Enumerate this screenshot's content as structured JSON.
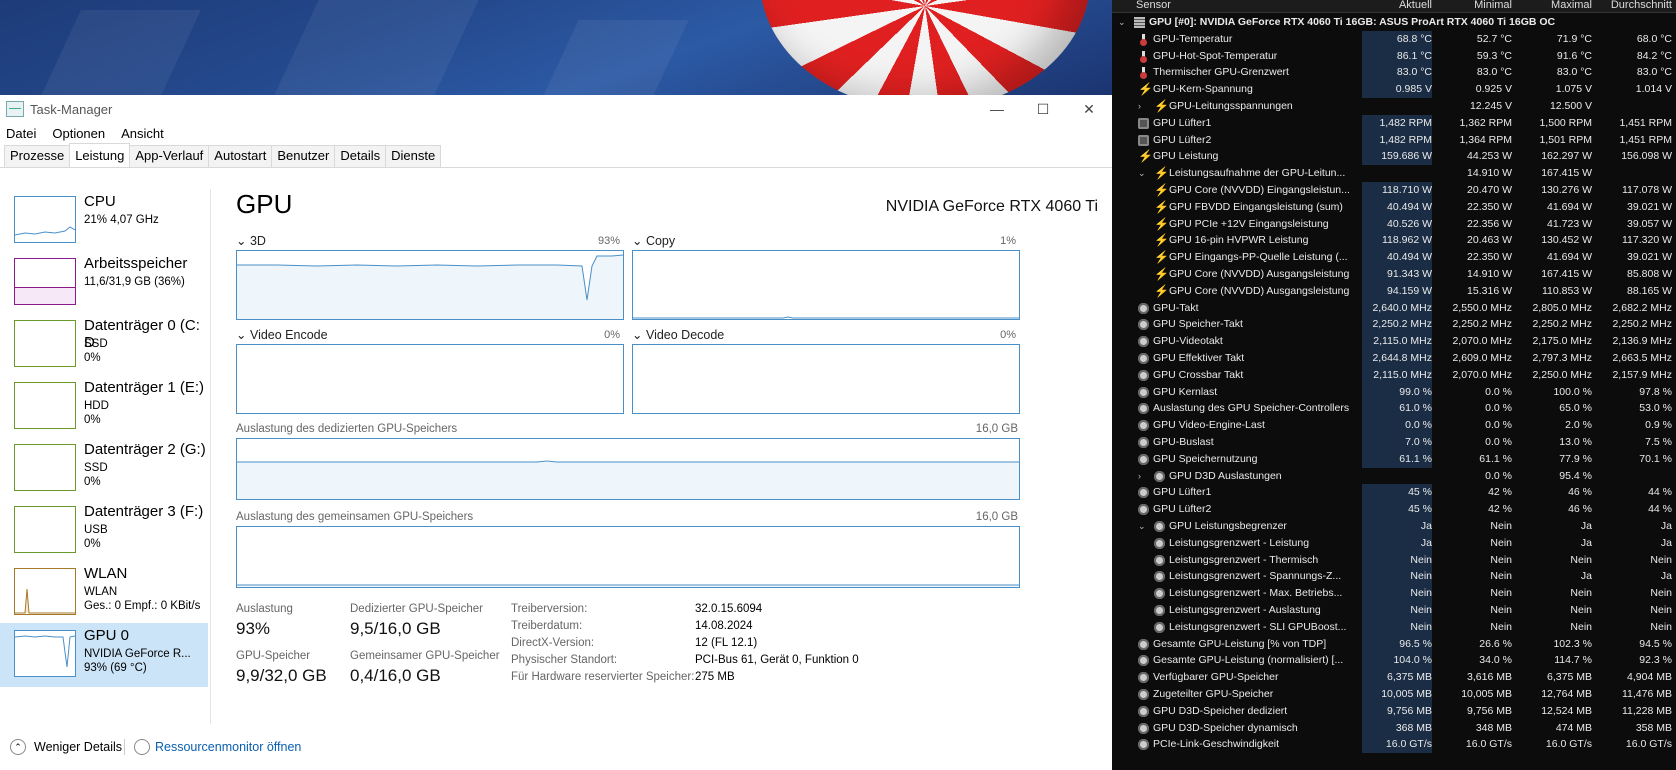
{
  "taskmanager": {
    "title": "Task-Manager",
    "window_controls": [
      "—",
      "☐",
      "✕"
    ],
    "menu": [
      "Datei",
      "Optionen",
      "Ansicht"
    ],
    "tabs": [
      "Prozesse",
      "Leistung",
      "App-Verlauf",
      "Autostart",
      "Benutzer",
      "Details",
      "Dienste"
    ],
    "active_tab": "Leistung",
    "sidebar": [
      {
        "name": "CPU",
        "sub1": "21% 4,07 GHz",
        "sub2": ""
      },
      {
        "name": "Arbeitsspeicher",
        "sub1": "11,6/31,9 GB (36%)",
        "sub2": ""
      },
      {
        "name": "Datenträger 0 (C: D",
        "sub1": "SSD",
        "sub2": "0%"
      },
      {
        "name": "Datenträger 1 (E:)",
        "sub1": "HDD",
        "sub2": "0%"
      },
      {
        "name": "Datenträger 2 (G:)",
        "sub1": "SSD",
        "sub2": "0%"
      },
      {
        "name": "Datenträger 3 (F:)",
        "sub1": "USB",
        "sub2": "0%"
      },
      {
        "name": "WLAN",
        "sub1": "WLAN",
        "sub2": "Ges.: 0 Empf.: 0 KBit/s"
      },
      {
        "name": "GPU 0",
        "sub1": "NVIDIA GeForce R...",
        "sub2": "93% (69 °C)"
      }
    ],
    "main": {
      "heading": "GPU",
      "gpu_name": "NVIDIA GeForce RTX 4060 Ti",
      "engines": [
        {
          "label": "3D",
          "percent": "93%",
          "level": 0.93
        },
        {
          "label": "Copy",
          "percent": "1%",
          "level": 0.01
        },
        {
          "label": "Video Encode",
          "percent": "0%",
          "level": 0
        },
        {
          "label": "Video Decode",
          "percent": "0%",
          "level": 0
        }
      ],
      "dedicated_label": "Auslastung des dedizierten GPU-Speichers",
      "dedicated_max": "16,0 GB",
      "dedicated_level": 0.61,
      "shared_label": "Auslastung des gemeinsamen GPU-Speichers",
      "shared_max": "16,0 GB",
      "shared_level": 0.025,
      "stats": {
        "auslastung_label": "Auslastung",
        "auslastung_value": "93%",
        "dedicated_mem_label": "Dedizierter GPU-Speicher",
        "dedicated_mem_value": "9,5/16,0 GB",
        "gpu_mem_label": "GPU-Speicher",
        "gpu_mem_value": "9,9/32,0 GB",
        "shared_mem_label": "Gemeinsamer GPU-Speicher",
        "shared_mem_value": "0,4/16,0 GB"
      },
      "info": [
        {
          "k": "Treiberversion:",
          "v": "32.0.15.6094"
        },
        {
          "k": "Treiberdatum:",
          "v": "14.08.2024"
        },
        {
          "k": "DirectX-Version:",
          "v": "12 (FL 12.1)"
        },
        {
          "k": "Physischer Standort:",
          "v": "PCI-Bus 61, Gerät 0, Funktion 0"
        },
        {
          "k": "Für Hardware reservierter Speicher:",
          "v": "275 MB"
        }
      ]
    },
    "bottom": {
      "fewer_details": "Weniger Details",
      "resource_monitor": "Ressourcenmonitor öffnen"
    }
  },
  "hwinfo": {
    "columns": [
      "Sensor",
      "Aktuell",
      "Minimal",
      "Maximal",
      "Durchschnitt"
    ],
    "rows": [
      {
        "indent": 0,
        "icon": "chip",
        "expand": "v",
        "label": "GPU [#0]: NVIDIA GeForce RTX 4060 Ti 16GB: ASUS ProArt RTX 4060 Ti 16GB OC",
        "head": true,
        "cur": "",
        "min": "",
        "max": "",
        "avg": ""
      },
      {
        "indent": 1,
        "icon": "temp",
        "label": "GPU-Temperatur",
        "cur": "68.8 °C",
        "min": "52.7 °C",
        "max": "71.9 °C",
        "avg": "68.0 °C"
      },
      {
        "indent": 1,
        "icon": "temp",
        "label": "GPU-Hot-Spot-Temperatur",
        "cur": "86.1 °C",
        "min": "59.3 °C",
        "max": "91.6 °C",
        "avg": "84.2 °C"
      },
      {
        "indent": 1,
        "icon": "temp",
        "label": "Thermischer GPU-Grenzwert",
        "cur": "83.0 °C",
        "min": "83.0 °C",
        "max": "83.0 °C",
        "avg": "83.0 °C"
      },
      {
        "indent": 1,
        "icon": "volt",
        "label": "GPU-Kern-Spannung",
        "cur": "0.985 V",
        "min": "0.925 V",
        "max": "1.075 V",
        "avg": "1.014 V"
      },
      {
        "indent": 2,
        "icon": "volt",
        "expand": ">",
        "label": "GPU-Leitungsspannungen",
        "cur": "",
        "min": "12.245 V",
        "max": "12.500 V",
        "avg": ""
      },
      {
        "indent": 1,
        "icon": "fan",
        "label": "GPU Lüfter1",
        "cur": "1,482 RPM",
        "min": "1,362 RPM",
        "max": "1,500 RPM",
        "avg": "1,451 RPM"
      },
      {
        "indent": 1,
        "icon": "fan",
        "label": "GPU Lüfter2",
        "cur": "1,482 RPM",
        "min": "1,364 RPM",
        "max": "1,501 RPM",
        "avg": "1,451 RPM"
      },
      {
        "indent": 1,
        "icon": "volt",
        "label": "GPU Leistung",
        "cur": "159.686 W",
        "min": "44.253 W",
        "max": "162.297 W",
        "avg": "156.098 W"
      },
      {
        "indent": 2,
        "icon": "volt",
        "expand": "v",
        "label": "Leistungsaufnahme der GPU-Leitun...",
        "cur": "",
        "min": "14.910 W",
        "max": "167.415 W",
        "avg": ""
      },
      {
        "indent": 2,
        "icon": "volt",
        "label": "GPU Core (NVVDD) Eingangsleistun...",
        "cur": "118.710 W",
        "min": "20.470 W",
        "max": "130.276 W",
        "avg": "117.078 W"
      },
      {
        "indent": 2,
        "icon": "volt",
        "label": "GPU FBVDD Eingangsleistung (sum)",
        "cur": "40.494 W",
        "min": "22.350 W",
        "max": "41.694 W",
        "avg": "39.021 W"
      },
      {
        "indent": 2,
        "icon": "volt",
        "label": "GPU PCIe +12V Eingangsleistung",
        "cur": "40.526 W",
        "min": "22.356 W",
        "max": "41.723 W",
        "avg": "39.057 W"
      },
      {
        "indent": 2,
        "icon": "volt",
        "label": "GPU 16-pin HVPWR Leistung",
        "cur": "118.962 W",
        "min": "20.463 W",
        "max": "130.452 W",
        "avg": "117.320 W"
      },
      {
        "indent": 2,
        "icon": "volt",
        "label": "GPU Eingangs-PP-Quelle Leistung (...",
        "cur": "40.494 W",
        "min": "22.350 W",
        "max": "41.694 W",
        "avg": "39.021 W"
      },
      {
        "indent": 2,
        "icon": "volt",
        "label": "GPU Core (NVVDD) Ausgangsleistung",
        "cur": "91.343 W",
        "min": "14.910 W",
        "max": "167.415 W",
        "avg": "85.808 W"
      },
      {
        "indent": 2,
        "icon": "volt",
        "label": "GPU Core (NVVDD) Ausgangsleistung",
        "cur": "94.159 W",
        "min": "15.316 W",
        "max": "110.853 W",
        "avg": "88.165 W"
      },
      {
        "indent": 1,
        "icon": "clk",
        "label": "GPU-Takt",
        "cur": "2,640.0 MHz",
        "min": "2,550.0 MHz",
        "max": "2,805.0 MHz",
        "avg": "2,682.2 MHz"
      },
      {
        "indent": 1,
        "icon": "clk",
        "label": "GPU Speicher-Takt",
        "cur": "2,250.2 MHz",
        "min": "2,250.2 MHz",
        "max": "2,250.2 MHz",
        "avg": "2,250.2 MHz"
      },
      {
        "indent": 1,
        "icon": "clk",
        "label": "GPU-Videotakt",
        "cur": "2,115.0 MHz",
        "min": "2,070.0 MHz",
        "max": "2,175.0 MHz",
        "avg": "2,136.9 MHz"
      },
      {
        "indent": 1,
        "icon": "clk",
        "label": "GPU Effektiver Takt",
        "cur": "2,644.8 MHz",
        "min": "2,609.0 MHz",
        "max": "2,797.3 MHz",
        "avg": "2,663.5 MHz"
      },
      {
        "indent": 1,
        "icon": "clk",
        "label": "GPU Crossbar Takt",
        "cur": "2,115.0 MHz",
        "min": "2,070.0 MHz",
        "max": "2,250.0 MHz",
        "avg": "2,157.9 MHz"
      },
      {
        "indent": 1,
        "icon": "clk",
        "label": "GPU Kernlast",
        "cur": "99.0 %",
        "min": "0.0 %",
        "max": "100.0 %",
        "avg": "97.8 %"
      },
      {
        "indent": 1,
        "icon": "clk",
        "label": "Auslastung des GPU Speicher-Controllers",
        "cur": "61.0 %",
        "min": "0.0 %",
        "max": "65.0 %",
        "avg": "53.0 %"
      },
      {
        "indent": 1,
        "icon": "clk",
        "label": "GPU Video-Engine-Last",
        "cur": "0.0 %",
        "min": "0.0 %",
        "max": "2.0 %",
        "avg": "0.9 %"
      },
      {
        "indent": 1,
        "icon": "clk",
        "label": "GPU-Buslast",
        "cur": "7.0 %",
        "min": "0.0 %",
        "max": "13.0 %",
        "avg": "7.5 %"
      },
      {
        "indent": 1,
        "icon": "clk",
        "label": "GPU Speichernutzung",
        "cur": "61.1 %",
        "min": "61.1 %",
        "max": "77.9 %",
        "avg": "70.1 %"
      },
      {
        "indent": 2,
        "icon": "clk",
        "expand": ">",
        "label": "GPU D3D Auslastungen",
        "cur": "",
        "min": "0.0 %",
        "max": "95.4 %",
        "avg": ""
      },
      {
        "indent": 1,
        "icon": "clk",
        "label": "GPU Lüfter1",
        "cur": "45 %",
        "min": "42 %",
        "max": "46 %",
        "avg": "44 %"
      },
      {
        "indent": 1,
        "icon": "clk",
        "label": "GPU Lüfter2",
        "cur": "45 %",
        "min": "42 %",
        "max": "46 %",
        "avg": "44 %"
      },
      {
        "indent": 2,
        "icon": "clk",
        "expand": "v",
        "label": "GPU Leistungsbegrenzer",
        "cur": "Ja",
        "min": "Nein",
        "max": "Ja",
        "avg": "Ja"
      },
      {
        "indent": 2,
        "icon": "clk",
        "label": "Leistungsgrenzwert - Leistung",
        "cur": "Ja",
        "min": "Nein",
        "max": "Ja",
        "avg": "Ja"
      },
      {
        "indent": 2,
        "icon": "clk",
        "label": "Leistungsgrenzwert - Thermisch",
        "cur": "Nein",
        "min": "Nein",
        "max": "Nein",
        "avg": "Nein"
      },
      {
        "indent": 2,
        "icon": "clk",
        "label": "Leistungsgrenzwert - Spannungs-Z...",
        "cur": "Nein",
        "min": "Nein",
        "max": "Ja",
        "avg": "Ja"
      },
      {
        "indent": 2,
        "icon": "clk",
        "label": "Leistungsgrenzwert - Max. Betriebs...",
        "cur": "Nein",
        "min": "Nein",
        "max": "Nein",
        "avg": "Nein"
      },
      {
        "indent": 2,
        "icon": "clk",
        "label": "Leistungsgrenzwert - Auslastung",
        "cur": "Nein",
        "min": "Nein",
        "max": "Nein",
        "avg": "Nein"
      },
      {
        "indent": 2,
        "icon": "clk",
        "label": "Leistungsgrenzwert - SLI GPUBoost...",
        "cur": "Nein",
        "min": "Nein",
        "max": "Nein",
        "avg": "Nein"
      },
      {
        "indent": 1,
        "icon": "clk",
        "label": "Gesamte GPU-Leistung [% von TDP]",
        "cur": "96.5 %",
        "min": "26.6 %",
        "max": "102.3 %",
        "avg": "94.5 %"
      },
      {
        "indent": 1,
        "icon": "clk",
        "label": "Gesamte GPU-Leistung (normalisiert) [...",
        "cur": "104.0 %",
        "min": "34.0 %",
        "max": "114.7 %",
        "avg": "92.3 %"
      },
      {
        "indent": 1,
        "icon": "clk",
        "label": "Verfügbarer GPU-Speicher",
        "cur": "6,375 MB",
        "min": "3,616 MB",
        "max": "6,375 MB",
        "avg": "4,904 MB"
      },
      {
        "indent": 1,
        "icon": "clk",
        "label": "Zugeteilter GPU-Speicher",
        "cur": "10,005 MB",
        "min": "10,005 MB",
        "max": "12,764 MB",
        "avg": "11,476 MB"
      },
      {
        "indent": 1,
        "icon": "clk",
        "label": "GPU D3D-Speicher dediziert",
        "cur": "9,756 MB",
        "min": "9,756 MB",
        "max": "12,524 MB",
        "avg": "11,228 MB"
      },
      {
        "indent": 1,
        "icon": "clk",
        "label": "GPU D3D-Speicher dynamisch",
        "cur": "368 MB",
        "min": "348 MB",
        "max": "474 MB",
        "avg": "358 MB"
      },
      {
        "indent": 1,
        "icon": "clk",
        "label": "PCIe-Link-Geschwindigkeit",
        "cur": "16.0 GT/s",
        "min": "16.0 GT/s",
        "max": "16.0 GT/s",
        "avg": "16.0 GT/s"
      }
    ]
  }
}
